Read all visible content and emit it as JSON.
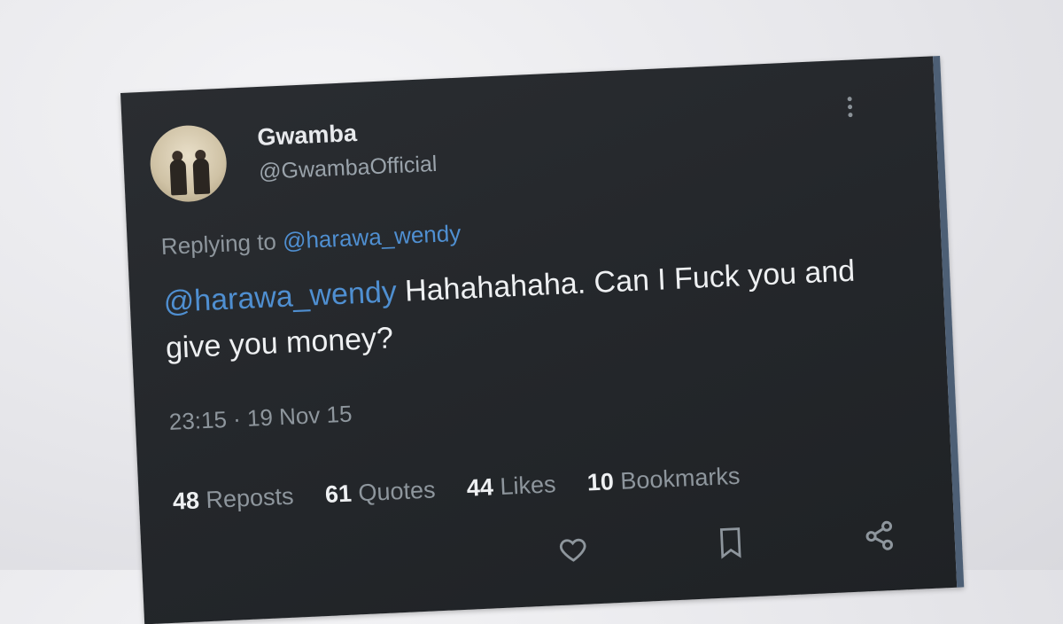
{
  "tweet": {
    "display_name": "Gwamba",
    "handle": "@GwambaOfficial",
    "replying_prefix": "Replying to ",
    "replying_to": "@harawa_wendy",
    "text_mention": "@harawa_wendy",
    "text_body": " Hahahahaha. Can I Fuck you and give you money?",
    "timestamp": "23:15 · 19 Nov 15",
    "stats": {
      "reposts_count": "48",
      "reposts_label": "Reposts",
      "quotes_count": "61",
      "quotes_label": "Quotes",
      "likes_count": "44",
      "likes_label": "Likes",
      "bookmarks_count": "10",
      "bookmarks_label": "Bookmarks"
    }
  },
  "colors": {
    "background": "#242629",
    "mention": "#4f8fd1",
    "muted_text": "#8e969d",
    "primary_text": "#eef0f2"
  },
  "icons": [
    "more-icon",
    "like-icon",
    "bookmark-icon",
    "share-icon"
  ]
}
